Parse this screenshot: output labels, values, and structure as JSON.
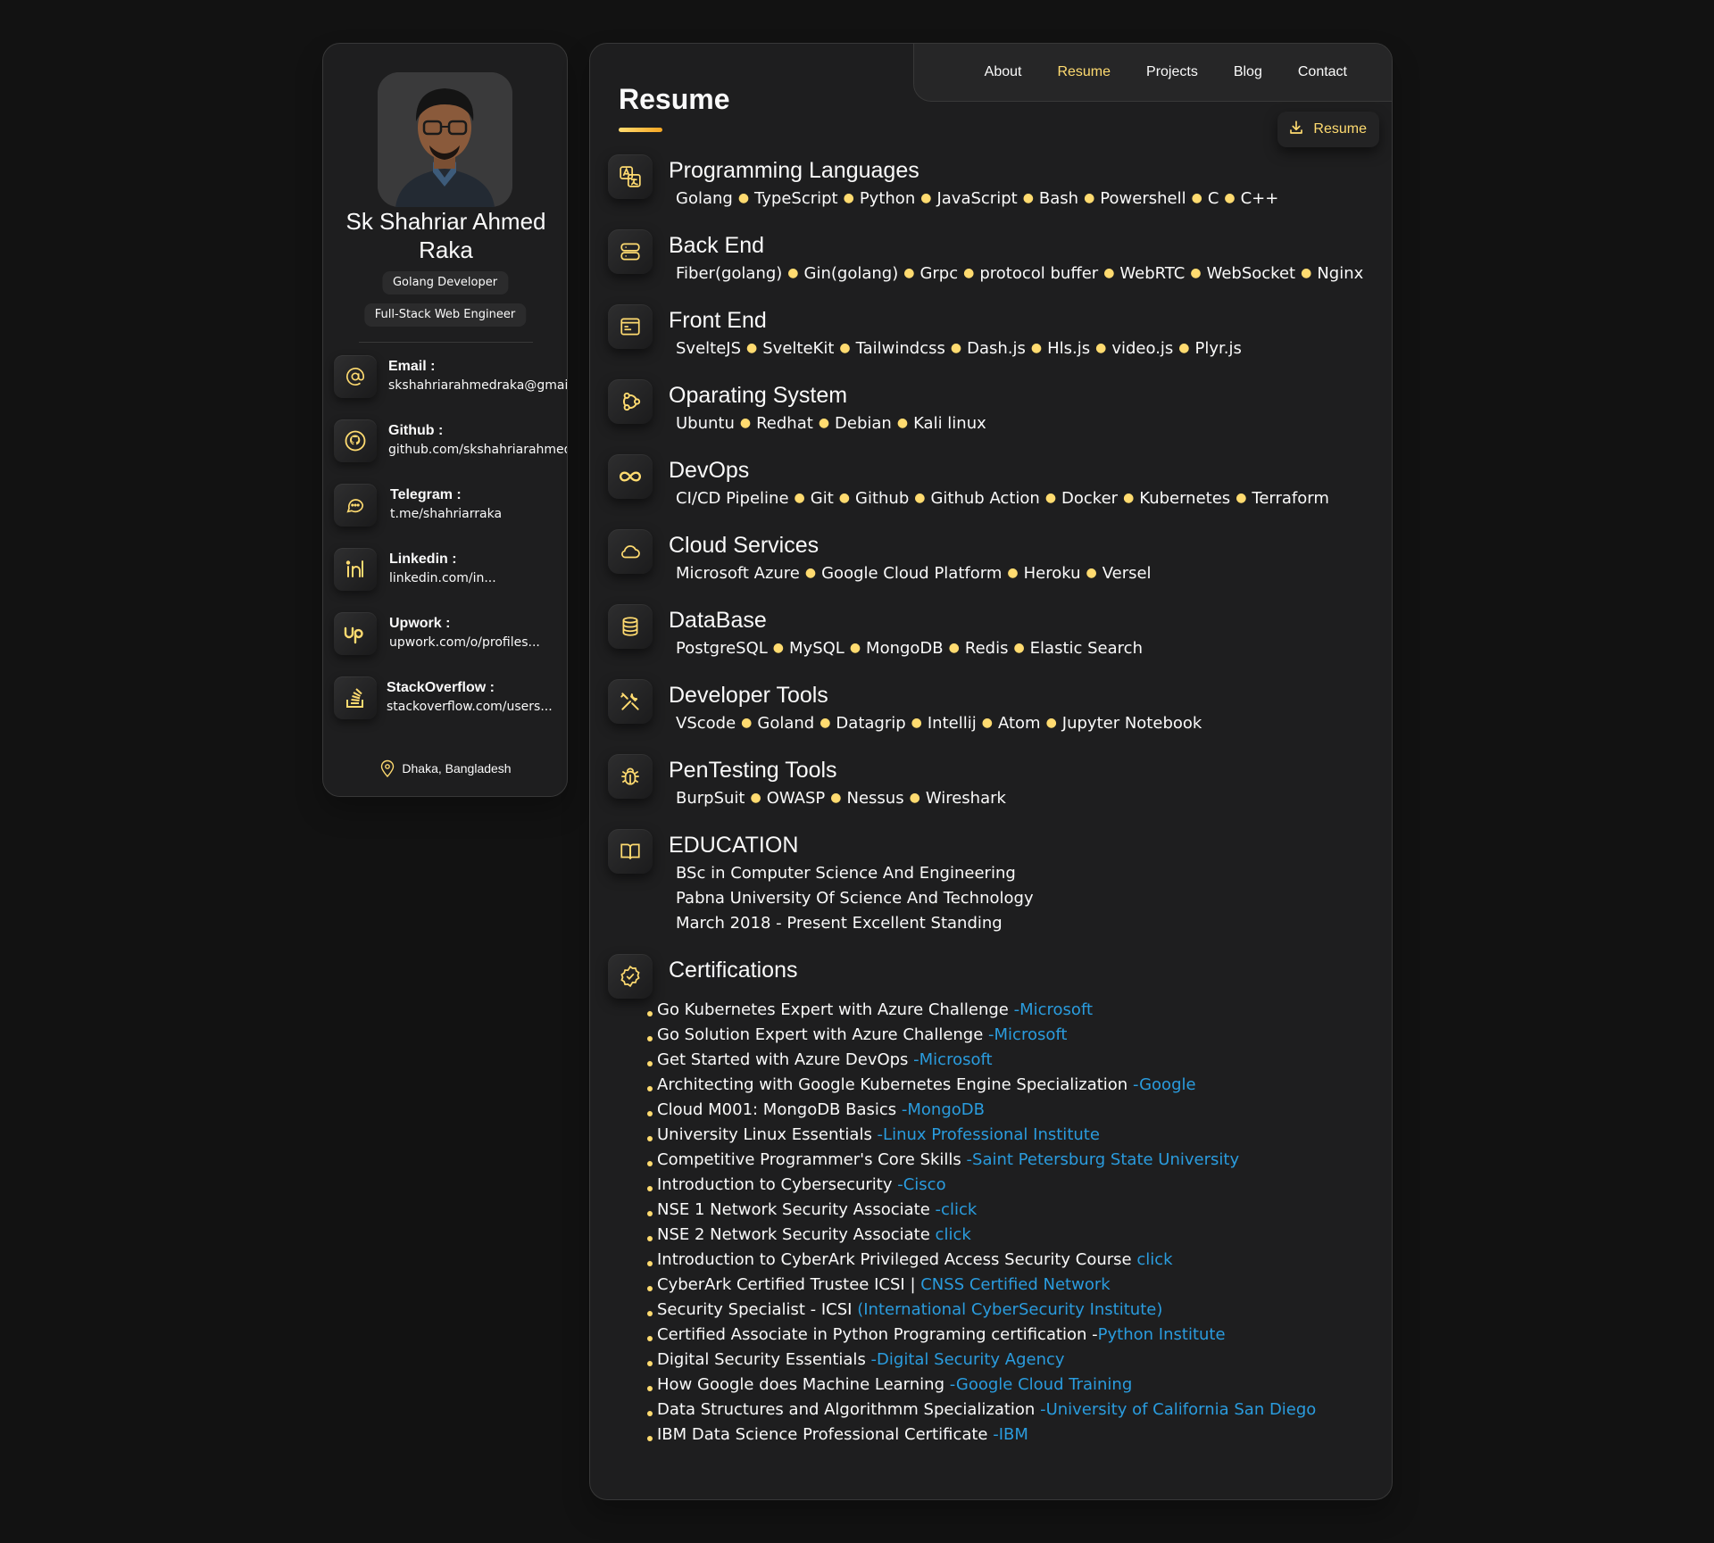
{
  "profile": {
    "name": "Sk Shahriar Ahmed Raka",
    "roles": [
      "Golang Developer",
      "Full-Stack Web Engineer"
    ],
    "avatar_alt": "avatar",
    "contacts": [
      {
        "title": "Email :",
        "value": "skshahriarahmedraka@gmail.com",
        "icon": "at-icon"
      },
      {
        "title": "Github :",
        "value": "github.com/skshahriarahmedraka",
        "icon": "github-icon"
      },
      {
        "title": "Telegram :",
        "value": "t.me/shahriarraka",
        "icon": "chat-icon"
      },
      {
        "title": "Linkedin :",
        "value": "linkedin.com/in...",
        "icon": "linkedin-icon"
      },
      {
        "title": "Upwork :",
        "value": "upwork.com/o/profiles...",
        "icon": "upwork-icon"
      },
      {
        "title": "StackOverflow :",
        "value": "stackoverflow.com/users...",
        "icon": "stackoverflow-icon"
      }
    ],
    "location": "Dhaka, Bangladesh"
  },
  "nav": {
    "links": [
      "About",
      "Resume",
      "Projects",
      "Blog",
      "Contact"
    ],
    "active": "Resume"
  },
  "page": {
    "title": "Resume",
    "download_label": "Resume"
  },
  "sections": [
    {
      "title": "Programming Languages",
      "icon": "translate-icon",
      "items": [
        "Golang",
        "TypeScript",
        "Python",
        "JavaScript",
        "Bash",
        "Powershell",
        "C",
        "C++"
      ]
    },
    {
      "title": "Back End",
      "icon": "server-icon",
      "items": [
        "Fiber(golang)",
        "Gin(golang)",
        "Grpc",
        "protocol buffer",
        "WebRTC",
        "WebSocket",
        "Nginx"
      ]
    },
    {
      "title": "Front End",
      "icon": "browser-icon",
      "items": [
        "SvelteJS",
        "SvelteKit",
        "Tailwindcss",
        "Dash.js",
        "Hls.js",
        "video.js",
        "Plyr.js"
      ]
    },
    {
      "title": "Oparating System",
      "icon": "ubuntu-icon",
      "items": [
        "Ubuntu",
        "Redhat",
        "Debian",
        "Kali linux"
      ]
    },
    {
      "title": "DevOps",
      "icon": "infinity-icon",
      "items": [
        "CI/CD Pipeline",
        "Git",
        "Github",
        "Github Action",
        "Docker",
        "Kubernetes",
        "Terraform"
      ]
    },
    {
      "title": "Cloud Services",
      "icon": "cloud-icon",
      "items": [
        "Microsoft Azure",
        "Google Cloud Platform",
        "Heroku",
        "Versel"
      ]
    },
    {
      "title": "DataBase",
      "icon": "database-icon",
      "items": [
        "PostgreSQL",
        "MySQL",
        "MongoDB",
        "Redis",
        "Elastic Search"
      ]
    },
    {
      "title": "Developer Tools",
      "icon": "tools-icon",
      "items": [
        "VScode",
        "Goland",
        "Datagrip",
        "Intellij",
        "Atom",
        "Jupyter Notebook"
      ]
    },
    {
      "title": "PenTesting Tools",
      "icon": "bug-icon",
      "items": [
        "BurpSuit",
        "OWASP",
        "Nessus",
        "Wireshark"
      ]
    }
  ],
  "education": {
    "title": "EDUCATION",
    "icon": "book-icon",
    "lines": [
      "BSc in Computer Science And Engineering",
      "Pabna University Of Science And Technology",
      "March 2018 - Present Excellent Standing"
    ]
  },
  "certifications": {
    "title": "Certifications",
    "icon": "badge-check-icon",
    "items": [
      {
        "name": "Go Kubernetes Expert with Azure Challenge ",
        "source": "-Microsoft"
      },
      {
        "name": "Go Solution Expert with Azure Challenge ",
        "source": "-Microsoft"
      },
      {
        "name": "Get Started with Azure DevOps ",
        "source": "-Microsoft"
      },
      {
        "name": "Architecting with Google Kubernetes Engine Specialization ",
        "source": "-Google"
      },
      {
        "name": "Cloud M001: MongoDB Basics ",
        "source": "-MongoDB"
      },
      {
        "name": "University Linux Essentials ",
        "source": "-Linux Professional Institute"
      },
      {
        "name": "Competitive Programmer's Core Skills ",
        "source": "-Saint Petersburg State University"
      },
      {
        "name": "Introduction to Cybersecurity ",
        "source": "-Cisco"
      },
      {
        "name": "NSE 1 Network Security Associate ",
        "source": "-click"
      },
      {
        "name": "NSE 2 Network Security Associate ",
        "source": "click"
      },
      {
        "name": "Introduction to CyberArk Privileged Access Security Course ",
        "source": "click"
      },
      {
        "name": "CyberArk Certified Trustee ICSI | ",
        "source": "CNSS Certified Network"
      },
      {
        "name": "Security Specialist - ICSI ",
        "source": "(International CyberSecurity Institute)"
      },
      {
        "name": "Certified Associate in Python Programing certification -",
        "source": "Python Institute"
      },
      {
        "name": "Digital Security Essentials ",
        "source": "-Digital Security Agency"
      },
      {
        "name": "How Google does Machine Learning ",
        "source": "-Google Cloud Training"
      },
      {
        "name": "Data Structures and Algorithmm Specialization ",
        "source": "-University of California San Diego"
      },
      {
        "name": "IBM Data Science Professional Certificate ",
        "source": "-IBM"
      }
    ]
  },
  "colors": {
    "accent": "#ffdb70",
    "link": "#2a9cde",
    "background": "#121212",
    "panel": "#1e1e1f"
  }
}
